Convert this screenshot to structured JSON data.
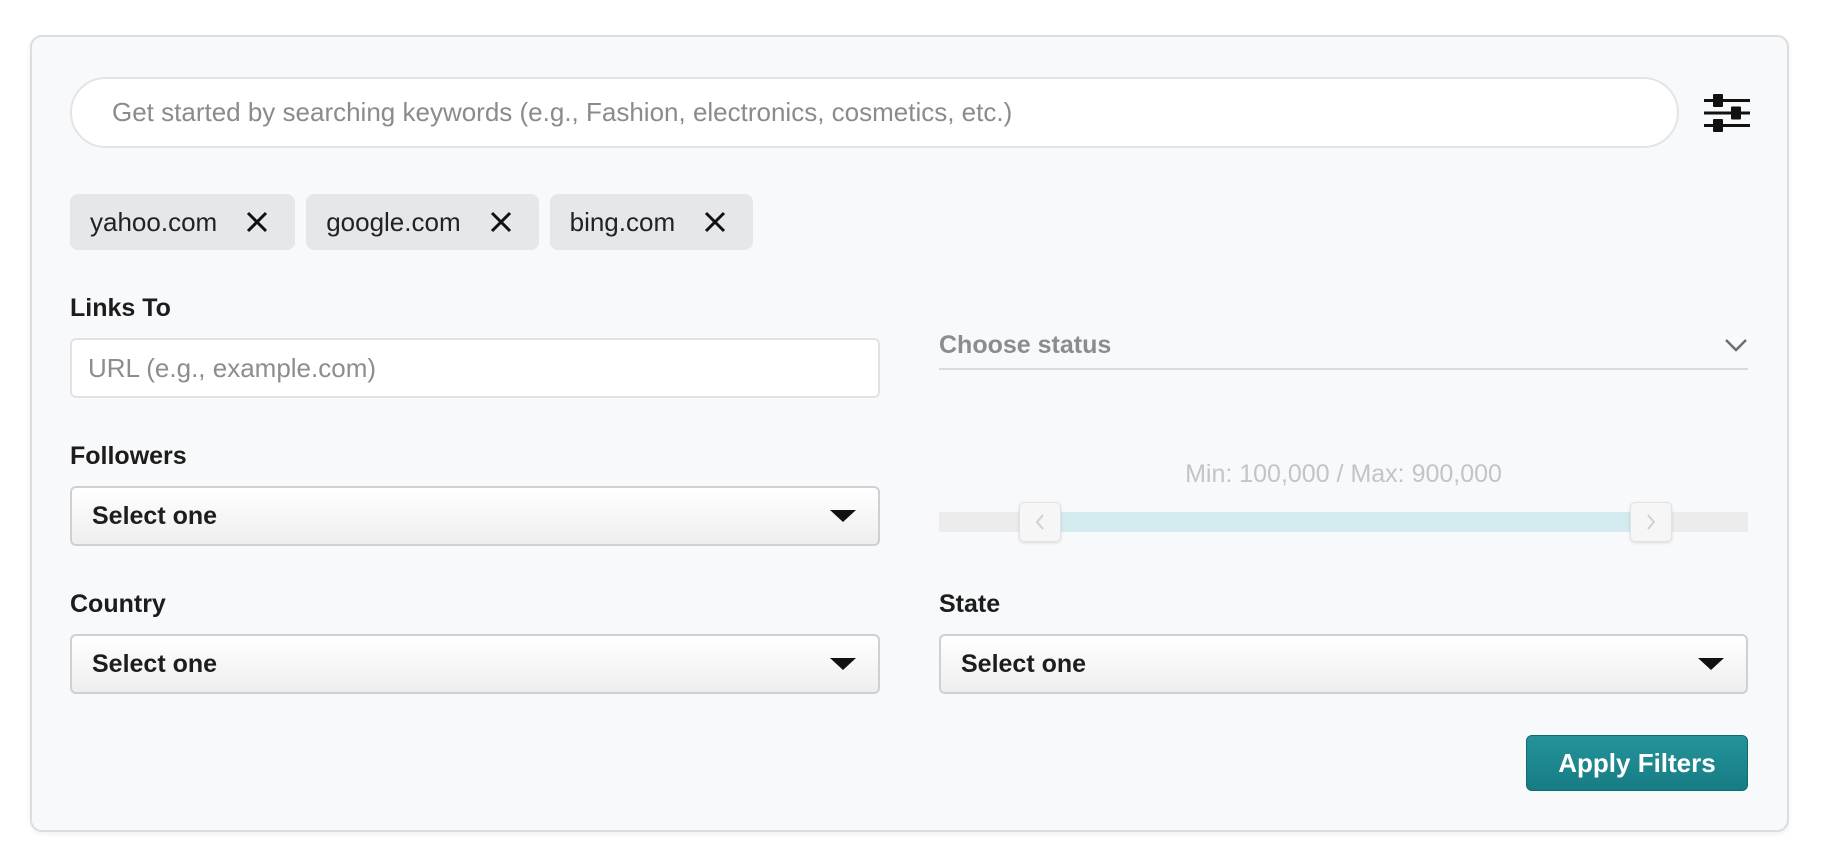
{
  "search": {
    "placeholder": "Get started by searching keywords (e.g., Fashion, electronics, cosmetics, etc.)",
    "value": ""
  },
  "filter_toggle": {
    "icon": "sliders-icon"
  },
  "chips": [
    {
      "label": "yahoo.com",
      "icon": "close-icon"
    },
    {
      "label": "google.com",
      "icon": "close-icon"
    },
    {
      "label": "bing.com",
      "icon": "close-icon"
    }
  ],
  "links_to": {
    "label": "Links To",
    "placeholder": "URL (e.g., example.com)",
    "value": ""
  },
  "status": {
    "placeholder": "Choose status",
    "icon": "chevron-down-icon"
  },
  "followers": {
    "label": "Followers",
    "selected": "Select one"
  },
  "range": {
    "label": "Min: 100,000 / Max: 900,000",
    "min_value": 100000,
    "max_value": 900000,
    "min_fraction": 0.125,
    "max_fraction": 0.88
  },
  "country": {
    "label": "Country",
    "selected": "Select one"
  },
  "state": {
    "label": "State",
    "selected": "Select one"
  },
  "apply_button": {
    "label": "Apply Filters"
  },
  "colors": {
    "accent": "#1b8a91",
    "range_fill": "#d4ecf0",
    "chip_bg": "#e6e7e9",
    "panel_bg": "#f8f9fb"
  }
}
